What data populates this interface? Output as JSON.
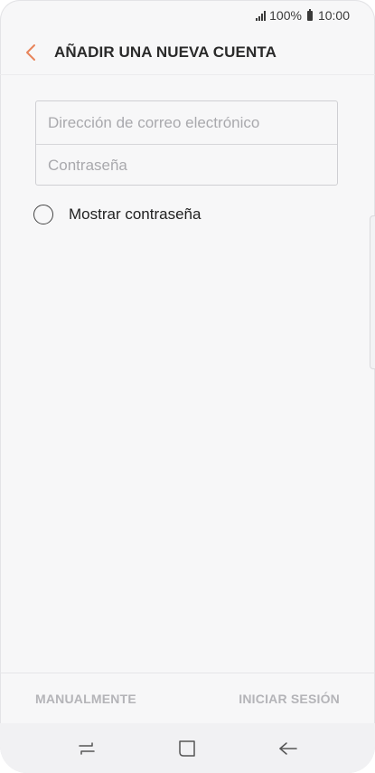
{
  "status_bar": {
    "battery": "100%",
    "time": "10:00",
    "signal_icon": "signal-bars-icon",
    "battery_icon": "battery-icon"
  },
  "app_bar": {
    "back_icon": "chevron-left-icon",
    "title": "AÑADIR UNA NUEVA CUENTA",
    "accent_color": "#e8845a"
  },
  "form": {
    "email": {
      "value": "",
      "placeholder": "Dirección de correo electrónico"
    },
    "password": {
      "value": "",
      "placeholder": "Contraseña"
    },
    "show_password": {
      "label": "Mostrar contraseña",
      "checked": false
    }
  },
  "actions": {
    "manual_label": "MANUALMENTE",
    "sign_in_label": "INICIAR SESIÓN"
  },
  "nav_bar": {
    "recents_icon": "recent-apps-icon",
    "home_icon": "home-icon",
    "back_icon": "back-arrow-icon"
  }
}
